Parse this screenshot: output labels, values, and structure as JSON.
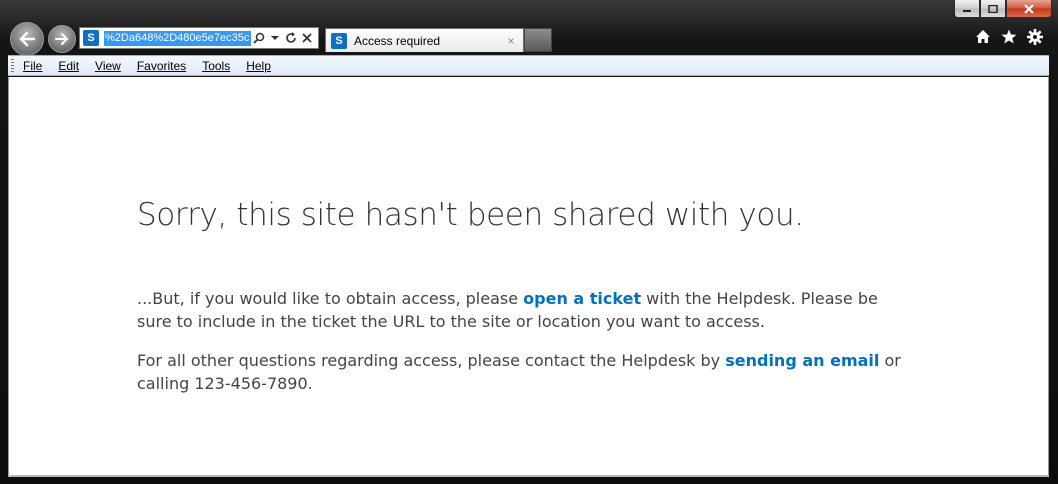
{
  "browser": {
    "address_url": "%2Da648%2D480e5e7ec35c",
    "tab_title": "Access required",
    "tab_close": "×",
    "nav_back_icon": "arrow-left-icon",
    "nav_forward_icon": "arrow-right-icon",
    "address_icons": [
      "search-icon",
      "dropdown-icon",
      "refresh-icon",
      "stop-icon"
    ],
    "toolbar_icons": [
      "home-icon",
      "favorites-star-icon",
      "settings-gear-icon"
    ]
  },
  "menu": {
    "items": [
      "File",
      "Edit",
      "View",
      "Favorites",
      "Tools",
      "Help"
    ]
  },
  "page": {
    "heading": "Sorry, this site hasn't been shared with you.",
    "p1_before": "...But, if you would like to obtain access, please ",
    "p1_link": "open a ticket",
    "p1_after": " with the Helpdesk. Please be sure to include in the ticket the URL to the site or location you want to access.",
    "p2_before": "For all other questions regarding access, please contact the Helpdesk by ",
    "p2_link": "sending an email",
    "p2_after": " or calling 123-456-7890."
  },
  "colors": {
    "link": "#0072c6",
    "url_selection": "#3399ff",
    "sharepoint_blue": "#0f6fc6"
  }
}
